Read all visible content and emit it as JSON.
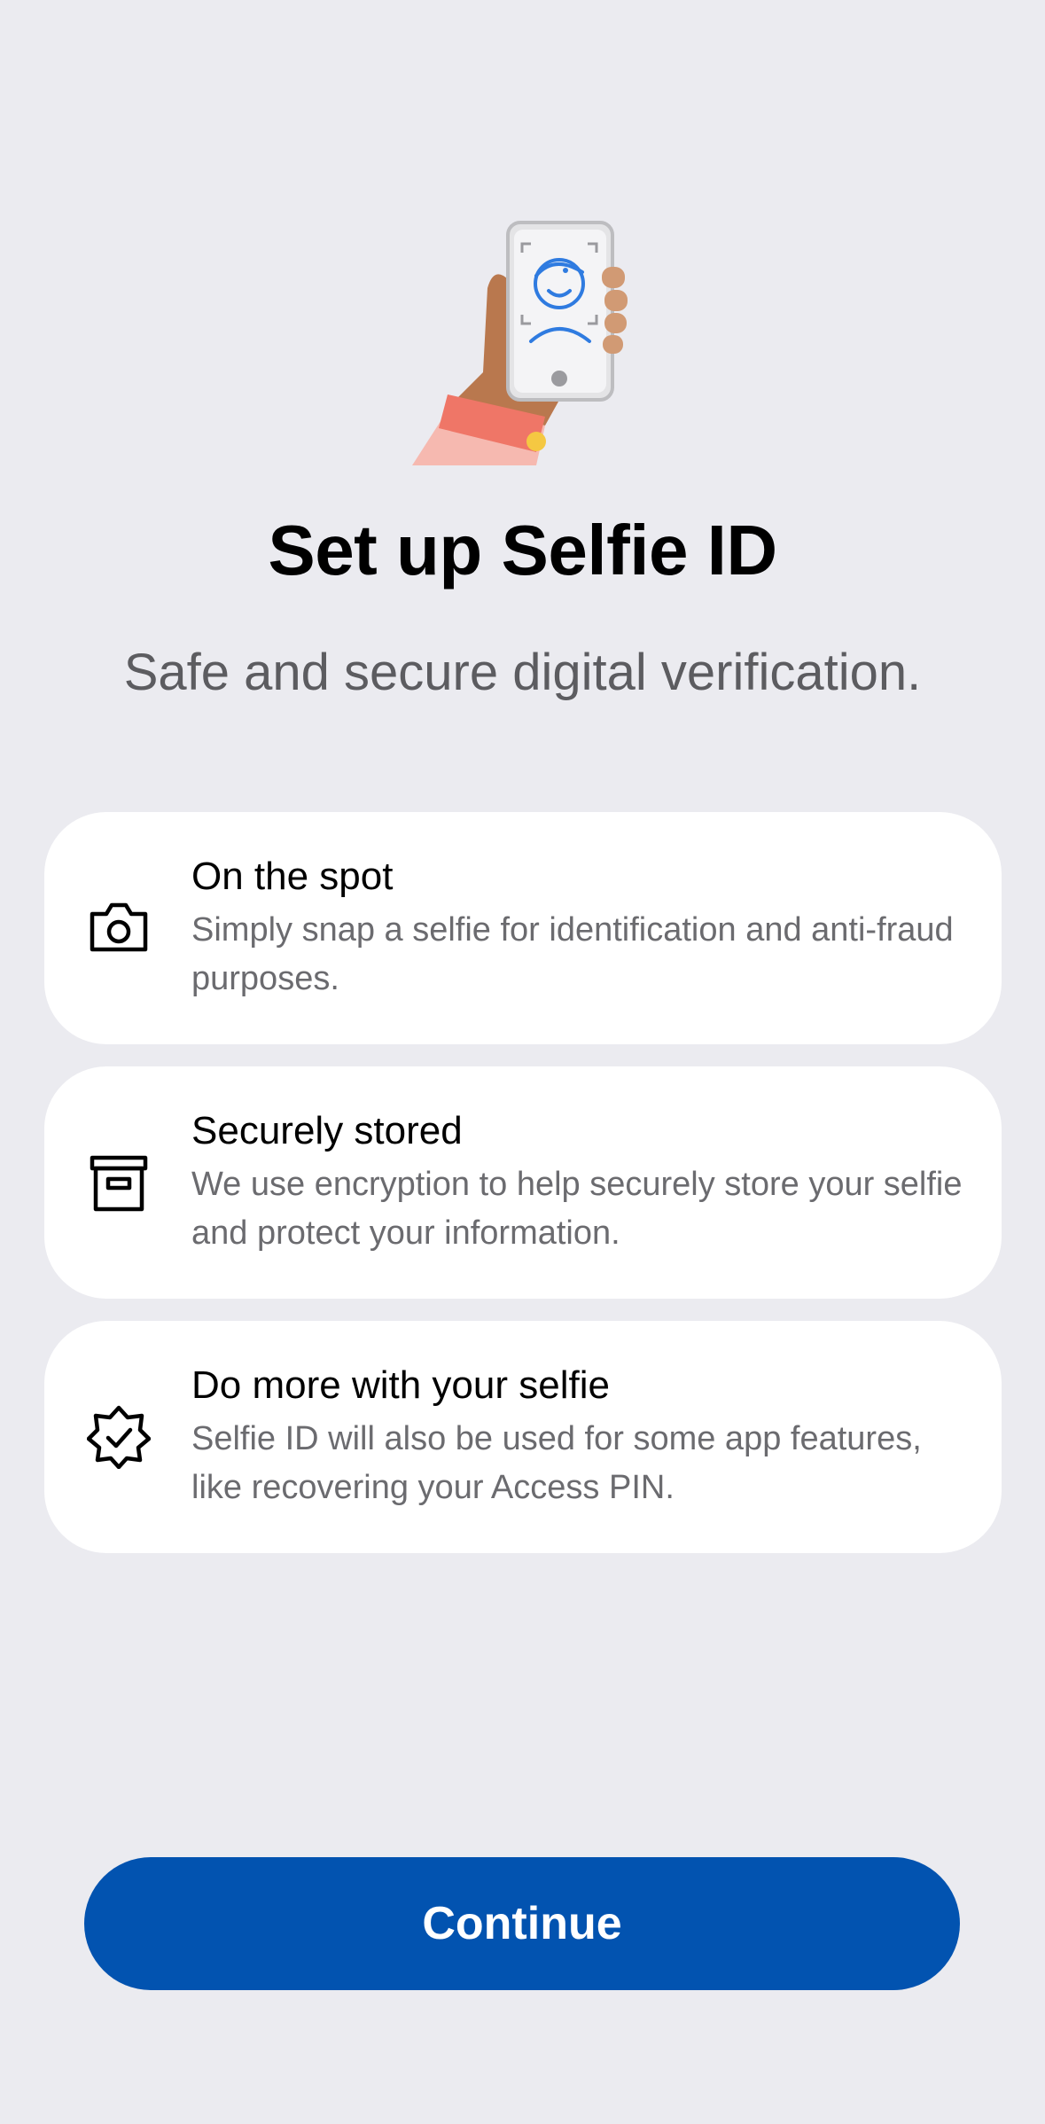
{
  "hero": {
    "icon": "hand-holding-phone-selfie-illustration"
  },
  "header": {
    "title": "Set up Selfie ID",
    "subtitle": "Safe and secure digital verification."
  },
  "features": [
    {
      "icon": "camera-icon",
      "title": "On the spot",
      "description": "Simply snap a selfie for identification and anti-fraud purposes."
    },
    {
      "icon": "archive-box-icon",
      "title": "Securely stored",
      "description": "We use encryption to help securely store your selfie and protect your information."
    },
    {
      "icon": "verified-badge-icon",
      "title": "Do more with your selfie",
      "description": "Selfie ID will also be used for some app features, like recovering your Access PIN."
    }
  ],
  "actions": {
    "continue_label": "Continue"
  },
  "colors": {
    "background": "#ebebf0",
    "card": "#ffffff",
    "primary": "#0253b0",
    "title": "#000000",
    "secondary_text": "#6b6b6f"
  }
}
